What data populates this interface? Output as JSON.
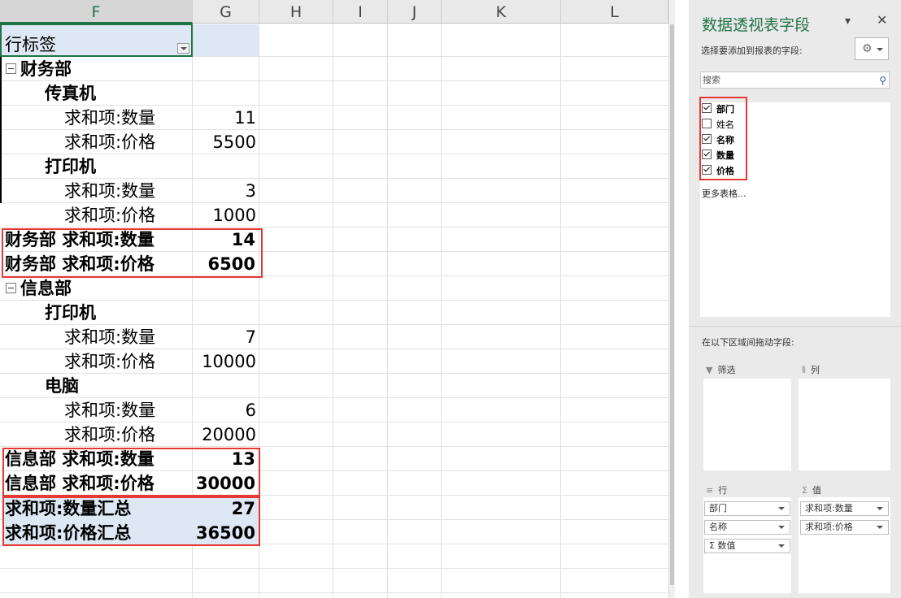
{
  "columns": [
    "F",
    "G",
    "H",
    "I",
    "J",
    "K",
    "L"
  ],
  "pivot": {
    "header": "行标签",
    "groups": [
      {
        "dept": "财务部",
        "items": [
          {
            "name": "传真机",
            "rows": [
              {
                "label": "求和项:数量",
                "value": "11"
              },
              {
                "label": "求和项:价格",
                "value": "5500"
              }
            ]
          },
          {
            "name": "打印机",
            "rows": [
              {
                "label": "求和项:数量",
                "value": "3"
              },
              {
                "label": "求和项:价格",
                "value": "1000"
              }
            ]
          }
        ],
        "subtotals": [
          {
            "label": "财务部 求和项:数量",
            "value": "14"
          },
          {
            "label": "财务部 求和项:价格",
            "value": "6500"
          }
        ]
      },
      {
        "dept": "信息部",
        "items": [
          {
            "name": "打印机",
            "rows": [
              {
                "label": "求和项:数量",
                "value": "7"
              },
              {
                "label": "求和项:价格",
                "value": "10000"
              }
            ]
          },
          {
            "name": "电脑",
            "rows": [
              {
                "label": "求和项:数量",
                "value": "6"
              },
              {
                "label": "求和项:价格",
                "value": "20000"
              }
            ]
          }
        ],
        "subtotals": [
          {
            "label": "信息部 求和项:数量",
            "value": "13"
          },
          {
            "label": "信息部 求和项:价格",
            "value": "30000"
          }
        ]
      }
    ],
    "grand_totals": [
      {
        "label": "求和项:数量汇总",
        "value": "27"
      },
      {
        "label": "求和项:价格汇总",
        "value": "36500"
      }
    ]
  },
  "pane": {
    "title": "数据透视表字段",
    "subtitle": "选择要添加到报表的字段:",
    "search_placeholder": "搜索",
    "fields": [
      {
        "label": "部门",
        "checked": true
      },
      {
        "label": "姓名",
        "checked": false
      },
      {
        "label": "名称",
        "checked": true
      },
      {
        "label": "数量",
        "checked": true
      },
      {
        "label": "价格",
        "checked": true
      }
    ],
    "more_tables": "更多表格...",
    "drag_label": "在以下区域间拖动字段:",
    "areas": {
      "filter": "筛选",
      "columns": "列",
      "rows": "行",
      "values": "值"
    },
    "rows_chips": [
      "部门",
      "名称",
      "Σ 数值"
    ],
    "values_chips": [
      "求和项:数量",
      "求和项:价格"
    ]
  },
  "colors": {
    "accent": "#217346",
    "highlight": "#e53935",
    "total_fill": "#dde8f4"
  }
}
